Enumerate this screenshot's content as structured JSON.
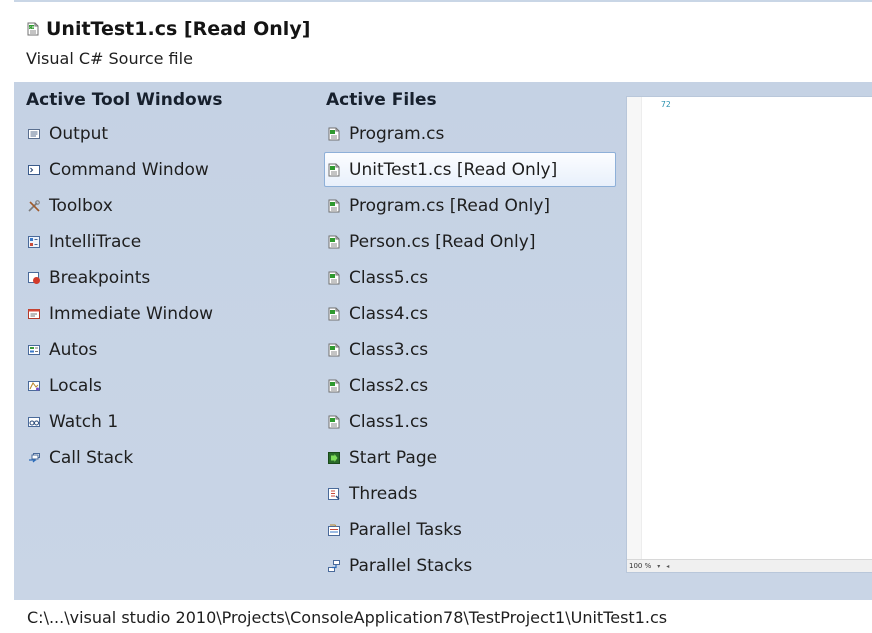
{
  "header": {
    "title": "UnitTest1.cs [Read Only]",
    "subtitle": "Visual C# Source file",
    "icon": "cs-file-icon"
  },
  "tool_windows": {
    "heading": "Active Tool Windows",
    "items": [
      {
        "label": "Output",
        "icon": "output-icon"
      },
      {
        "label": "Command Window",
        "icon": "command-window-icon"
      },
      {
        "label": "Toolbox",
        "icon": "toolbox-icon"
      },
      {
        "label": "IntelliTrace",
        "icon": "intellitrace-icon"
      },
      {
        "label": "Breakpoints",
        "icon": "breakpoints-icon"
      },
      {
        "label": "Immediate Window",
        "icon": "immediate-window-icon"
      },
      {
        "label": "Autos",
        "icon": "autos-icon"
      },
      {
        "label": "Locals",
        "icon": "locals-icon"
      },
      {
        "label": "Watch 1",
        "icon": "watch-icon"
      },
      {
        "label": "Call Stack",
        "icon": "call-stack-icon"
      }
    ]
  },
  "active_files": {
    "heading": "Active Files",
    "selected": "UnitTest1.cs [Read Only]",
    "items": [
      {
        "label": "Program.cs",
        "icon": "cs-file-icon"
      },
      {
        "label": "UnitTest1.cs [Read Only]",
        "icon": "cs-file-icon"
      },
      {
        "label": "Program.cs [Read Only]",
        "icon": "cs-file-icon"
      },
      {
        "label": "Person.cs [Read Only]",
        "icon": "cs-file-icon"
      },
      {
        "label": "Class5.cs",
        "icon": "cs-file-icon"
      },
      {
        "label": "Class4.cs",
        "icon": "cs-file-icon"
      },
      {
        "label": "Class3.cs",
        "icon": "cs-file-icon"
      },
      {
        "label": "Class2.cs",
        "icon": "cs-file-icon"
      },
      {
        "label": "Class1.cs",
        "icon": "cs-file-icon"
      },
      {
        "label": "Start Page",
        "icon": "start-page-icon"
      },
      {
        "label": "Threads",
        "icon": "threads-icon"
      },
      {
        "label": "Parallel Tasks",
        "icon": "parallel-tasks-icon"
      },
      {
        "label": "Parallel Stacks",
        "icon": "parallel-stacks-icon"
      }
    ]
  },
  "preview": {
    "line_number": "72",
    "zoom": "100 %"
  },
  "footer": {
    "path": "C:\\...\\visual studio 2010\\Projects\\ConsoleApplication78\\TestProject1\\UnitTest1.cs"
  },
  "colors": {
    "panel": "#c5d2e4",
    "selection_border": "#8eb0d8",
    "line_number": "#2b91af"
  }
}
